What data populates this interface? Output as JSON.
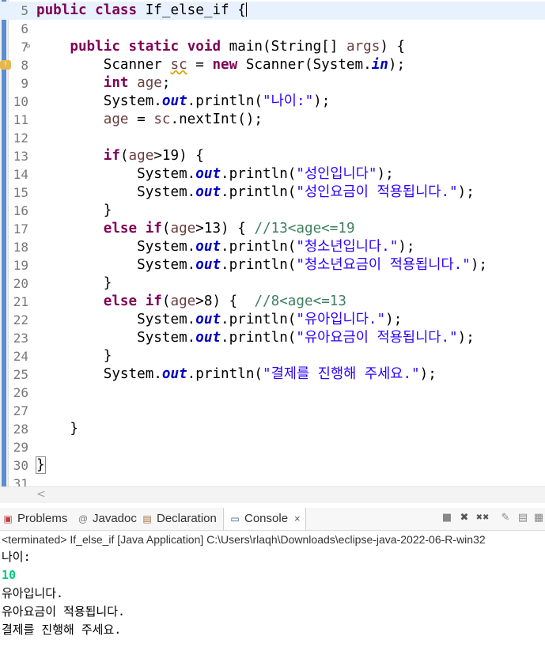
{
  "editor": {
    "lines": [
      {
        "n": "5",
        "html": "<span class=\"kw\">public</span> <span class=\"kw\">class</span> If_else_if {<span class=\"cursor\"></span>",
        "current": true
      },
      {
        "n": "6",
        "html": ""
      },
      {
        "n": "7",
        "html": "    <span class=\"kw\">public</span> <span class=\"kw\">static</span> <span class=\"kw\">void</span> main(String[] <span class=\"vr\">args</span>) {",
        "fold": true
      },
      {
        "n": "8",
        "html": "        Scanner <span class=\"vr squig\">sc</span> = <span class=\"kw\">new</span> Scanner(System.<span class=\"fd\">in</span>);",
        "marker": true
      },
      {
        "n": "9",
        "html": "        <span class=\"kw\">int</span> <span class=\"vr\">age</span>;"
      },
      {
        "n": "10",
        "html": "        System.<span class=\"fd\">out</span>.println(<span class=\"st\">\"나이:\"</span>);"
      },
      {
        "n": "11",
        "html": "        <span class=\"vr\">age</span> = <span class=\"vr\">sc</span>.nextInt();"
      },
      {
        "n": "12",
        "html": ""
      },
      {
        "n": "13",
        "html": "        <span class=\"kw\">if</span>(<span class=\"vr\">age</span>&gt;19) {"
      },
      {
        "n": "14",
        "html": "            System.<span class=\"fd\">out</span>.println(<span class=\"st\">\"성인입니다\"</span>);"
      },
      {
        "n": "15",
        "html": "            System.<span class=\"fd\">out</span>.println(<span class=\"st\">\"성인요금이 적용됩니다.\"</span>);"
      },
      {
        "n": "16",
        "html": "        }"
      },
      {
        "n": "17",
        "html": "        <span class=\"kw\">else</span> <span class=\"kw\">if</span>(<span class=\"vr\">age</span>&gt;13) { <span class=\"cm\">//13&lt;age&lt;=19</span>"
      },
      {
        "n": "18",
        "html": "            System.<span class=\"fd\">out</span>.println(<span class=\"st\">\"청소년입니다.\"</span>);"
      },
      {
        "n": "19",
        "html": "            System.<span class=\"fd\">out</span>.println(<span class=\"st\">\"청소년요금이 적용됩니다.\"</span>);"
      },
      {
        "n": "20",
        "html": "        }"
      },
      {
        "n": "21",
        "html": "        <span class=\"kw\">else</span> <span class=\"kw\">if</span>(<span class=\"vr\">age</span>&gt;8) {  <span class=\"cm\">//8&lt;age&lt;=13</span>"
      },
      {
        "n": "22",
        "html": "            System.<span class=\"fd\">out</span>.println(<span class=\"st\">\"유아입니다.\"</span>);"
      },
      {
        "n": "23",
        "html": "            System.<span class=\"fd\">out</span>.println(<span class=\"st\">\"유아요금이 적용됩니다.\"</span>);"
      },
      {
        "n": "24",
        "html": "        }"
      },
      {
        "n": "25",
        "html": "        System.<span class=\"fd\">out</span>.println(<span class=\"st\">\"결제를 진행해 주세요.\"</span>);"
      },
      {
        "n": "26",
        "html": ""
      },
      {
        "n": "27",
        "html": ""
      },
      {
        "n": "28",
        "html": "    }"
      },
      {
        "n": "29",
        "html": ""
      },
      {
        "n": "30",
        "html": "<span class=\"bracket-box\">}</span>"
      },
      {
        "n": "31",
        "html": ""
      }
    ]
  },
  "hscroll": {
    "arrow": "<"
  },
  "tabs": {
    "problems": "Problems",
    "javadoc": "Javadoc",
    "declaration": "Declaration",
    "console": "Console",
    "close": "×"
  },
  "toolbar": {
    "stop": "■",
    "remove": "✖",
    "remove_all": "✖✖",
    "clear": "✎",
    "scroll_lock": "▤",
    "pin": "▦"
  },
  "console": {
    "header": "<terminated> If_else_if [Java Application] C:\\Users\\rlaqh\\Downloads\\eclipse-java-2022-06-R-win32",
    "lines": [
      {
        "text": "나이:",
        "type": "output"
      },
      {
        "text": "10",
        "type": "input"
      },
      {
        "text": "유아입니다.",
        "type": "output"
      },
      {
        "text": "유아요금이 적용됩니다.",
        "type": "output"
      },
      {
        "text": "결제를 진행해 주세요.",
        "type": "output"
      }
    ]
  },
  "colors": {
    "keyword": "#7f0055",
    "string": "#2a00ff",
    "field": "#0000c0",
    "comment": "#3f7f5f",
    "console_input": "#00c87d"
  }
}
